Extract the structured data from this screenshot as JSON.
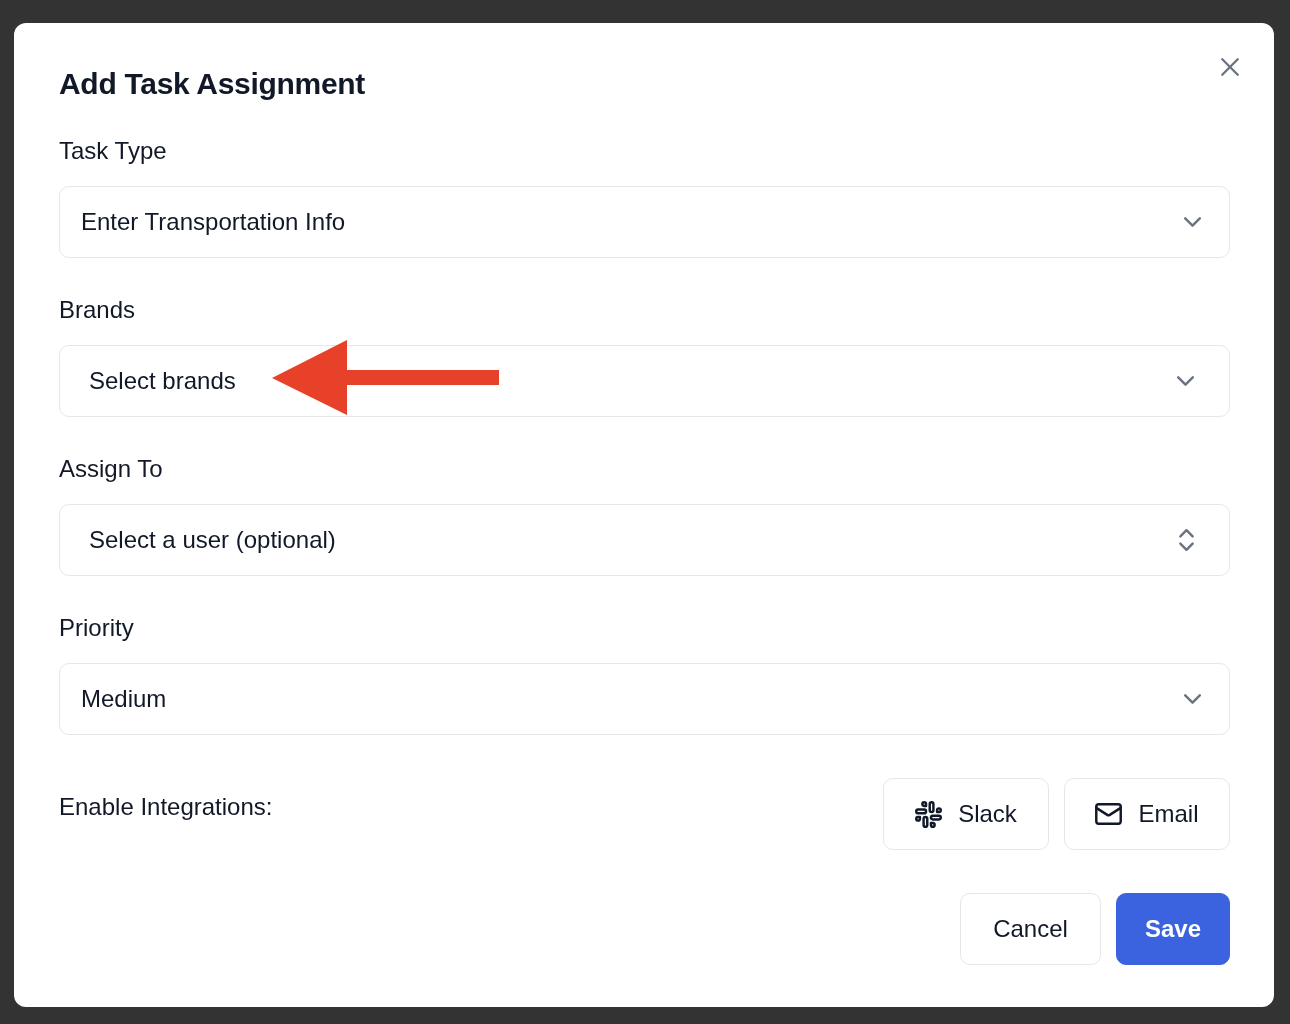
{
  "dialog": {
    "title": "Add Task Assignment"
  },
  "fields": [
    {
      "label": "Task Type",
      "kind": "select",
      "value": "Enter Transportation Info",
      "annotated": false
    },
    {
      "label": "Brands",
      "kind": "multiselect",
      "placeholder": "Select brands",
      "annotated": true
    },
    {
      "label": "Assign To",
      "kind": "combobox",
      "placeholder": "Select a user (optional)",
      "annotated": false
    },
    {
      "label": "Priority",
      "kind": "select",
      "value": "Medium",
      "annotated": false
    }
  ],
  "integrations": {
    "label": "Enable Integrations:",
    "options": [
      {
        "label": "Slack",
        "kind": "slack",
        "enabled": false
      },
      {
        "label": "Email",
        "kind": "email",
        "enabled": false
      }
    ]
  },
  "buttons": [
    {
      "label": "Cancel",
      "kind": "secondary"
    },
    {
      "label": "Save",
      "kind": "primary"
    }
  ]
}
